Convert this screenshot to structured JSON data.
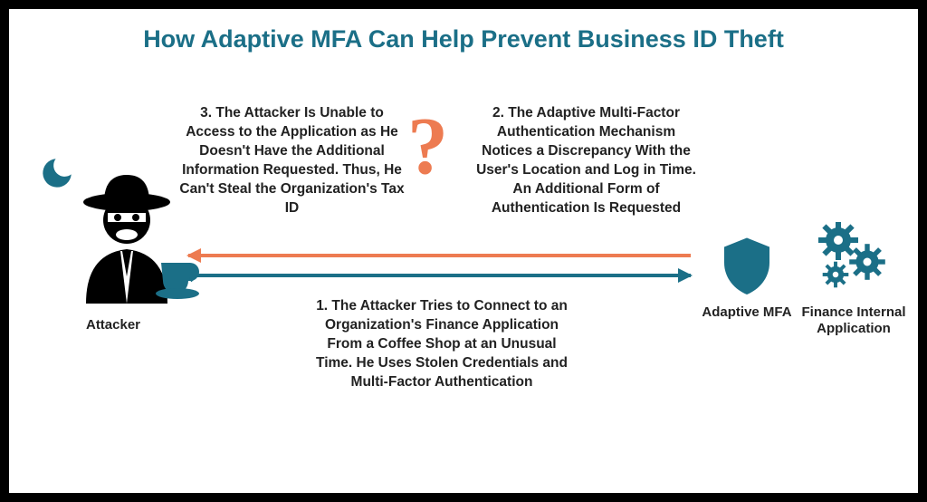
{
  "title": "How Adaptive MFA Can Help Prevent Business ID Theft",
  "labels": {
    "attacker": "Attacker",
    "mfa": "Adaptive MFA",
    "app": "Finance Internal Application"
  },
  "steps": {
    "s1": "1. The Attacker Tries to Connect to an Organization's Finance Application From a Coffee Shop at an Unusual Time. He Uses Stolen Credentials and Multi-Factor Authentication",
    "s2": "2. The Adaptive Multi-Factor Authentication Mechanism Notices a Discrepancy With the User's Location and Log in Time. An Additional Form of Authentication Is Requested",
    "s3": "3. The Attacker Is Unable to Access to the Application as He Doesn't Have the Additional Information Requested. Thus, He Can't Steal the Organization's Tax ID"
  },
  "icons": {
    "moon": "moon-icon",
    "coffee": "coffee-icon",
    "attacker": "attacker-icon",
    "shield": "shield-icon",
    "gears": "gears-icon",
    "question": "question-mark-icon"
  }
}
